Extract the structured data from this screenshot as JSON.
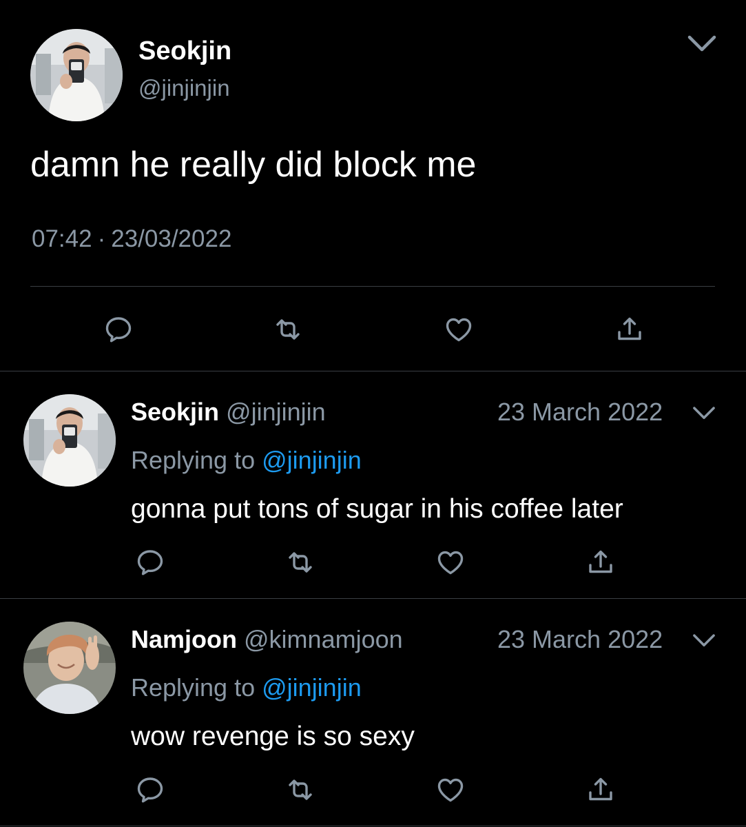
{
  "main_tweet": {
    "author": {
      "name": "Seokjin",
      "handle": "@jinjinjin",
      "avatar_icon": "avatar-photo-mirror-selfie"
    },
    "text": "damn he really did block me",
    "time": "07:42",
    "separator": "·",
    "date": "23/03/2022",
    "actions": [
      "reply-icon",
      "retweet-icon",
      "like-icon",
      "share-icon"
    ]
  },
  "replies": [
    {
      "name": "Seokjin",
      "handle": "@jinjinjin",
      "date": "23 March 2022",
      "replying_label": "Replying to",
      "replying_to": "@jinjinjin",
      "text": "gonna put tons of sugar in his coffee later",
      "avatar_icon": "avatar-photo-mirror-selfie"
    },
    {
      "name": "Namjoon",
      "handle": "@kimnamjoon",
      "date": "23 March 2022",
      "replying_label": "Replying to",
      "replying_to": "@jinjinjin",
      "text": "wow revenge is so sexy",
      "avatar_icon": "avatar-photo-peace-sign"
    }
  ],
  "colors": {
    "background": "#000000",
    "text": "#ffffff",
    "secondary_text": "#8b98a5",
    "link": "#1d9bf0",
    "divider": "#3a3f44"
  }
}
